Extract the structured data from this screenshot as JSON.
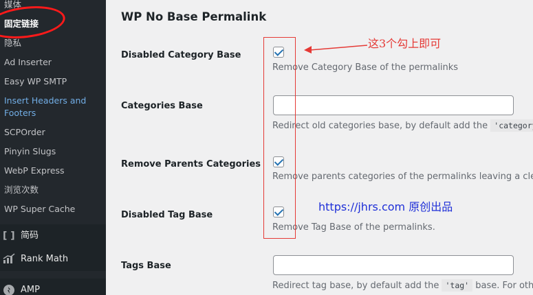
{
  "sidebar": {
    "items": [
      {
        "label": "媒体"
      },
      {
        "label": "固定链接"
      },
      {
        "label": "隐私"
      },
      {
        "label": "Ad Inserter"
      },
      {
        "label": "Easy WP SMTP"
      },
      {
        "label": "Insert Headers and"
      },
      {
        "label": "Footers"
      },
      {
        "label": "SCPOrder"
      },
      {
        "label": "Pinyin Slugs"
      },
      {
        "label": "WebP Express"
      },
      {
        "label": "浏览次数"
      },
      {
        "label": "WP Super Cache"
      }
    ],
    "menus": [
      {
        "label": "简码",
        "icon": "brackets-icon"
      },
      {
        "label": "Rank Math",
        "icon": "chart-icon"
      },
      {
        "label": "AMP",
        "icon": "amp-icon"
      }
    ]
  },
  "page": {
    "section_title": "WP No Base Permalink",
    "rows": {
      "disabled_category_base": {
        "label": "Disabled Category Base",
        "checked": true,
        "description": "Remove Category Base of the permalinks"
      },
      "categories_base": {
        "label": "Categories Base",
        "value": "",
        "desc_prefix": "Redirect old categories base, by default add the",
        "desc_code": "'category'"
      },
      "remove_parents_categories": {
        "label": "Remove Parents Categories",
        "checked": true,
        "description": "Remove parents categories of the permalinks leaving a cleaner"
      },
      "disabled_tag_base": {
        "label": "Disabled Tag Base",
        "checked": true,
        "description": "Remove Tag Base of the permalinks."
      },
      "tags_base": {
        "label": "Tags Base",
        "value": "",
        "desc_prefix": "Redirect tag base, by default add the",
        "desc_code": "'tag'",
        "desc_suffix": "base. For other"
      }
    }
  },
  "annotations": {
    "note": "这3个勾上即可",
    "watermark_url": "https://jhrs.com",
    "watermark_text": "原创出品",
    "color": "#e53935"
  }
}
